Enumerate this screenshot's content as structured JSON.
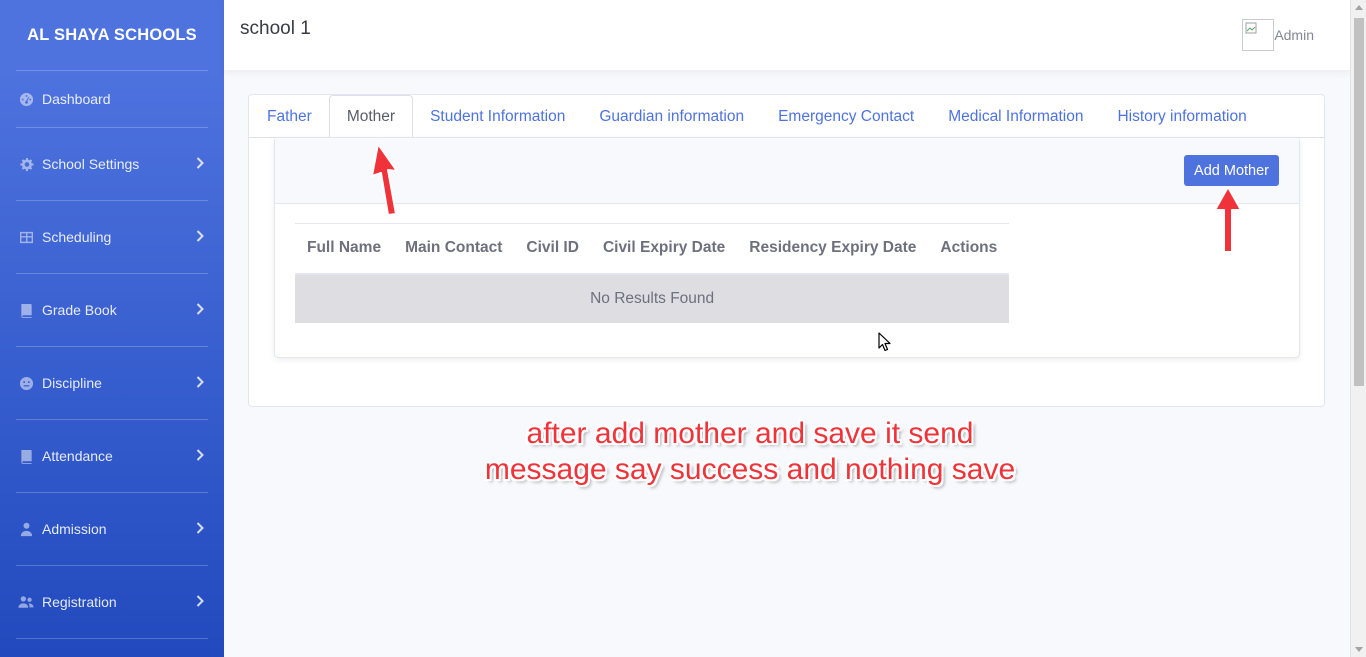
{
  "sidebar": {
    "brand": "AL SHAYA SCHOOLS",
    "items": [
      {
        "label": "Dashboard",
        "icon": "dashboard-icon",
        "has_chevron": false
      },
      {
        "label": "School Settings",
        "icon": "gear-icon",
        "has_chevron": true
      },
      {
        "label": "Scheduling",
        "icon": "table-icon",
        "has_chevron": true
      },
      {
        "label": "Grade Book",
        "icon": "book-icon",
        "has_chevron": true
      },
      {
        "label": "Discipline",
        "icon": "face-icon",
        "has_chevron": true
      },
      {
        "label": "Attendance",
        "icon": "book-icon",
        "has_chevron": true
      },
      {
        "label": "Admission",
        "icon": "user-icon",
        "has_chevron": true
      },
      {
        "label": "Registration",
        "icon": "users-icon",
        "has_chevron": true
      }
    ]
  },
  "header": {
    "title": "school 1",
    "user": "Admin"
  },
  "tabs": [
    {
      "label": "Father",
      "active": false
    },
    {
      "label": "Mother",
      "active": true
    },
    {
      "label": "Student Information",
      "active": false
    },
    {
      "label": "Guardian information",
      "active": false
    },
    {
      "label": "Emergency Contact",
      "active": false
    },
    {
      "label": "Medical Information",
      "active": false
    },
    {
      "label": "History information",
      "active": false
    }
  ],
  "panel": {
    "add_button": "Add Mother",
    "columns": [
      "Full Name",
      "Main Contact",
      "Civil ID",
      "Civil Expiry Date",
      "Residency Expiry Date",
      "Actions"
    ],
    "empty_message": "No Results Found"
  },
  "annotation": {
    "line1": "after add mother and save it send",
    "line2": "message say success and nothing save"
  },
  "colors": {
    "primary": "#4e73df",
    "annotation": "#f0333a"
  }
}
